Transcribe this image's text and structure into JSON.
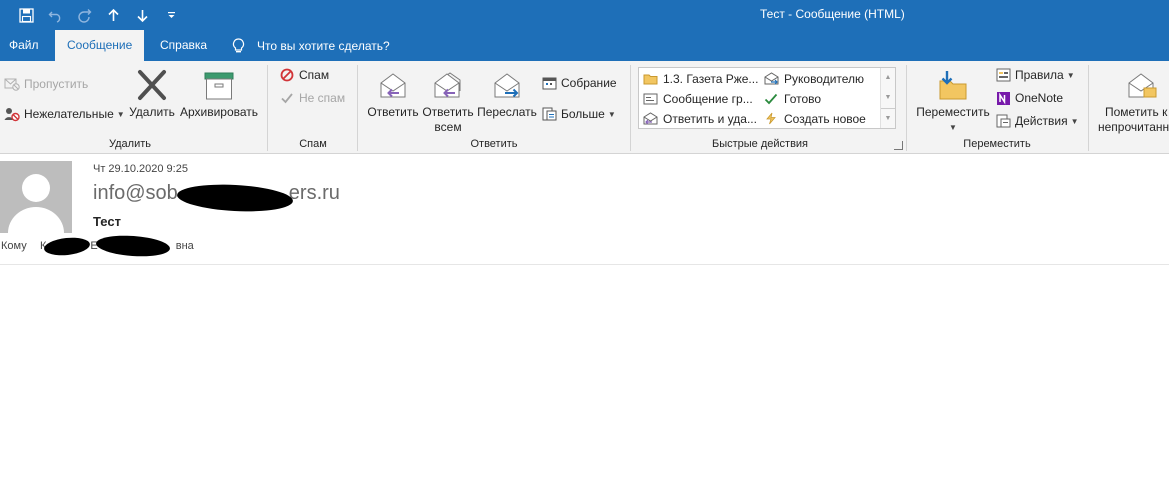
{
  "window": {
    "title": "Тест  -  Сообщение (HTML)"
  },
  "colors": {
    "accent": "#1e6fb8",
    "ribbon_bg": "#f3f3f3",
    "danger": "#d13438",
    "onenote": "#7719aa",
    "check": "#2b8a3e"
  },
  "qat": {
    "icons": [
      "save-icon",
      "undo-icon",
      "redo-icon",
      "arrow-up-icon",
      "arrow-down-icon",
      "customize-icon"
    ]
  },
  "tabs": [
    {
      "label": "Файл",
      "active": false
    },
    {
      "label": "Сообщение",
      "active": true
    },
    {
      "label": "Справка",
      "active": false
    }
  ],
  "tell_me": {
    "placeholder": "Что вы хотите сделать?"
  },
  "ribbon": {
    "delete_group": {
      "label": "Удалить",
      "ignore": "Пропустить",
      "junk": "Нежелательные",
      "delete": "Удалить",
      "archive": "Архивировать"
    },
    "spam_group": {
      "label": "Спам",
      "spam": "Спам",
      "not_spam": "Не спам"
    },
    "respond_group": {
      "label": "Ответить",
      "reply": "Ответить",
      "reply_all_1": "Ответить",
      "reply_all_2": "всем",
      "forward": "Переслать",
      "meeting": "Собрание",
      "more": "Больше"
    },
    "quicksteps_group": {
      "label": "Быстрые действия",
      "items": [
        "1.3. Газета Рже...",
        "Руководителю",
        "Сообщение гр...",
        "Готово",
        "Ответить и уда...",
        "Создать новое"
      ]
    },
    "move_group": {
      "label": "Переместить",
      "move": "Переместить",
      "rules": "Правила",
      "onenote": "OneNote",
      "actions": "Действия"
    },
    "tags_group": {
      "mark_unread_1": "Пометить к",
      "mark_unread_2": "непрочитанн"
    }
  },
  "message": {
    "date": "Чт 29.10.2020 9:25",
    "from_start": "info@sob",
    "from_end": "ers.ru",
    "subject": "Тест",
    "to_label": "Кому",
    "to_start": "К",
    "to_mid": "Е",
    "to_end": "вна"
  }
}
